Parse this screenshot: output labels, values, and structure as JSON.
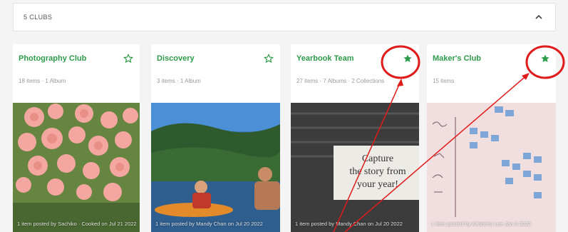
{
  "section": {
    "title": "5 CLUBS"
  },
  "colors": {
    "accent": "#2e9b4a",
    "annotation": "#e01b1b"
  },
  "cards": [
    {
      "title": "Photography Club",
      "meta": "18 items · 1 Album",
      "starred": false,
      "caption": "1 item posted by Sachiko · Cooked on Jul 21 2022"
    },
    {
      "title": "Discovery",
      "meta": "3 items · 1 Album",
      "starred": false,
      "caption": "1 item posted by Mandy Chan on Jul 20 2022"
    },
    {
      "title": "Yearbook Team",
      "meta": "27 items · 7 Albums · 2 Collections",
      "starred": true,
      "photo_text": [
        "Capture",
        "the story from",
        "your year!"
      ],
      "caption": "1 item posted by Mandy Chan on Jul 20 2022"
    },
    {
      "title": "Maker's Club",
      "meta": "15 items",
      "starred": true,
      "caption": "1 item posted by Kimberly Lee Jan 6 2022"
    }
  ],
  "icons": {
    "collapse": "chevron-up-icon",
    "star_empty": "star-outline-icon",
    "star_filled": "star-filled-icon"
  }
}
